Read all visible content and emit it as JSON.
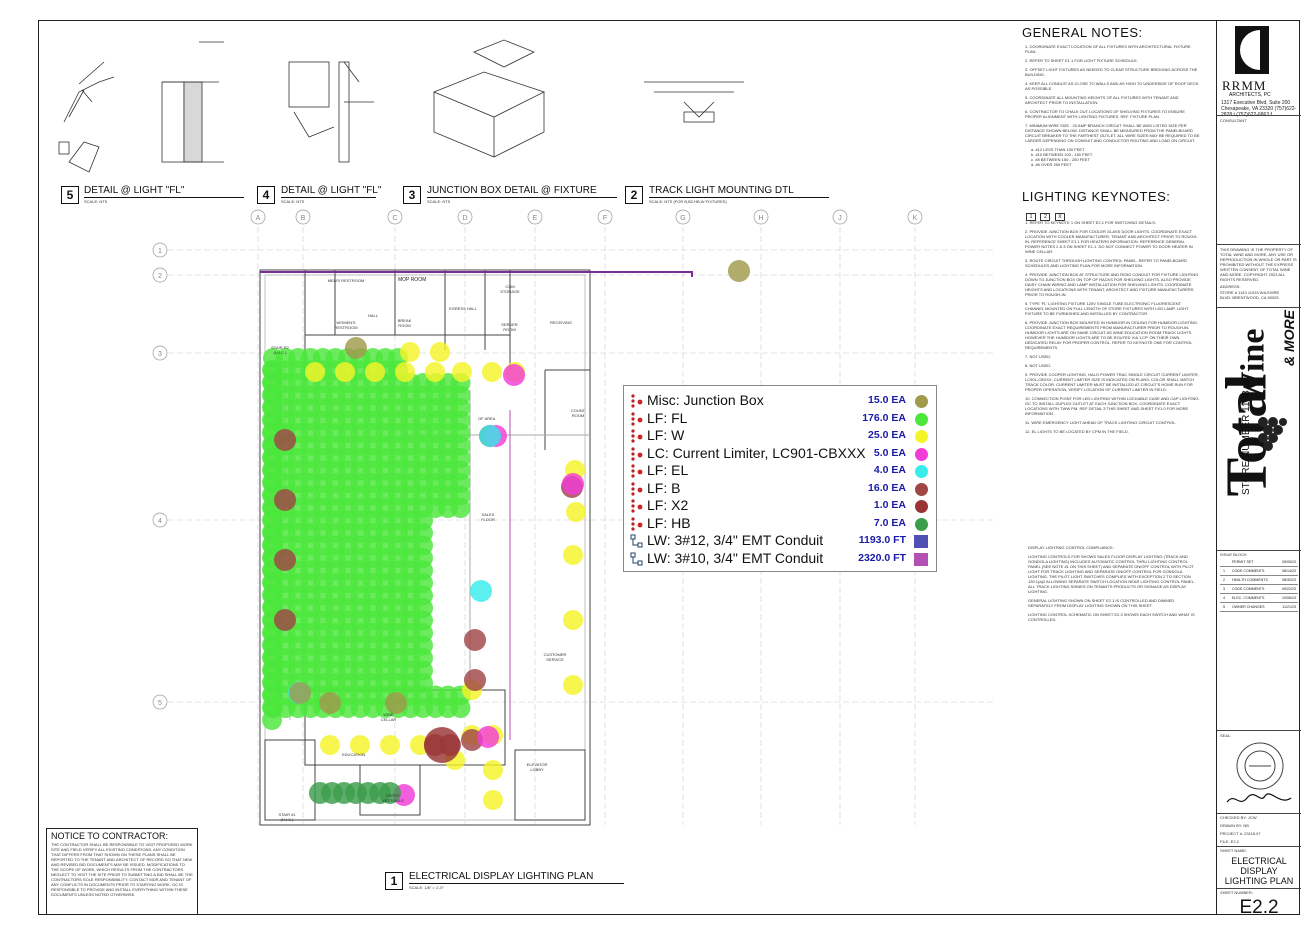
{
  "details": [
    {
      "num": "5",
      "title": "DETAIL @ LIGHT \"FL\"",
      "scale": "SCALE: NTS"
    },
    {
      "num": "4",
      "title": "DETAIL @ LIGHT \"FL\"",
      "scale": "SCALE: NTS"
    },
    {
      "num": "3",
      "title": "JUNCTION BOX DETAIL @ FIXTURE",
      "scale": "SCALE: NTS"
    },
    {
      "num": "2",
      "title": "TRACK LIGHT MOUNTING DTL",
      "scale": "SCALE: NTS (FOR B,B2,HB,W FIXTURES)"
    }
  ],
  "plan": {
    "num": "1",
    "title": "ELECTRICAL DISPLAY LIGHTING PLAN",
    "scale": "SCALE: 1/8\" = 1'-0\""
  },
  "grid_cols": [
    "A",
    "B",
    "C",
    "D",
    "E",
    "F",
    "G",
    "H",
    "J",
    "K"
  ],
  "grid_rows": [
    "1",
    "2",
    "3",
    "4",
    "5"
  ],
  "general_notes": {
    "title": "GENERAL NOTES:",
    "items": [
      "1.  COORDINATE EXACT LOCATION OF ALL FIXTURES WITH ARCHITECTURAL FIXTURE PLAN.",
      "2.  REFER TO SHEET E1.1 FOR LIGHT FIXTURE SCHEDULE.",
      "3.  OFFSET LIGHT FIXTURES AS NEEDED TO CLEAR STRUCTURE BRIDGING ACROSS THE BUILDING.",
      "4.  KEEP ALL CONDUIT AS CLOSE TO WALLS AND AS HIGH TO UNDERSIDE OF ROOF DECK AS POSSIBLE.",
      "5.  COORDINATE ALL MOUNTING HEIGHTS OF ALL FIXTURES WITH TENANT AND ARCHITECT PRIOR TO INSTALLATION.",
      "6.  CONTRACTOR TO CHALK OUT LOCATIONS OF SHELVING FIXTURES TO ENSURE PROPER ALIGNMENT WITH LIGHTING FIXTURES. REF. FIXTURE PLAN.",
      "7.  MINIMUM WIRE SIZE - 20 AMP BRANCH CIRCUIT SHALL BE AWG LISTED SIZE PER DISTANCE SHOWN BELOW. DISTANCE SHALL BE MEASURED FROM THE PANELBOARD CIRCUIT BREAKER TO THE FARTHEST OUTLET. ALL WIRE SIZES MAY BE REQUIRED TO BE LARGER DEPENDING ON CONDUIT AND CONDUCTOR ROUTING AND LOAD ON CIRCUIT."
    ],
    "wire_sizes": [
      "a. #12 LESS THAN 100 FEET",
      "b. #10 BETWEEN 100 - 150 FEET",
      "c. #8 BETWEEN 150 - 250 FEET",
      "d. #6 OVER 250 FEET"
    ]
  },
  "keynotes": {
    "title": "LIGHTING KEYNOTES:",
    "boxes": [
      "1",
      "2",
      "X"
    ],
    "items": [
      "1.  REFER TO KEYNOTE 1 ON SHEET E2.1 FOR SWITCHING DETAILS.",
      "2.  PROVIDE JUNCTION BOX FOR COOLER GLASS DOOR LIGHTS. COORDINATE EXACT LOCATION WITH COOLER MANUFACTURER, TENANT AND ARCHITECT PRIOR TO ROUGH-IN. REFERENCE SHEET E1.1 FOR HEATERS INFORMATION. REFERENCE GENERAL POWER NOTES 2 & 3 ON SHEET E1.1. DO NOT CONNECT POWER TO DOOR HEATER IN WINE CELLAR.",
      "3.  ROUTE CIRCUIT THROUGH LIGHTING CONTROL PANEL. REFER TO PANELBOARD SCHEDULES AND LIGHTING PLAN FOR MORE INFORMATION.",
      "4.  PROVIDE JUNCTION BOX AT STRUCTURE AND RIGID CONDUIT FOR FIXTURE LIGHTING DOWN TO JUNCTION BOX ON TOP OF RACKS FOR SHELVING LIGHTS. ALSO PROVIDE DAISY CHAIN WIRING AND LAMP INSTALLATION FOR SHELVING LIGHTS. COORDINATE HEIGHTS AND LOCATIONS WITH TENANT, ARCHITECT AND FIXTURE MANUFACTURERS PRIOR TO ROUGH-IN.",
      "5.  TYPE 'FL' LIGHTING FIXTURE 120V SINGLE TUBE ELECTRONIC FLUORESCENT CHANNEL MOUNTED ON FULL LENGTH OF STORE FIXTURES WITH LED LAMP. LIGHT FIXTURE TO BE FURNISHED AND INSTALLED BY CONTRACTOR.",
      "6.  PROVIDE JUNCTION BOX MOUNTED IN HUMIDOR IN CEILING FOR HUMIDOR LIGHTING. COORDINATE EXACT REQUIREMENTS FROM MANUFACTURER PRIOR TO ROUGH-IN. HUMIDOR LIGHTS ARE ON SAME CIRCUIT AS WINE EDUCATION ROOM TRACK LIGHTS HOWEVER THE HUMIDOR LIGHTS ARE TO BE ROUTED VIA 'LCP' ON THEIR OWN DEDICATED RELAY FOR PROPER CONTROL. REFER TO KEYNOTE ONE FOR CONTROL REQUIREMENTS.",
      "7.  NOT USED.",
      "8.  NOT USED.",
      "9.  PROVIDE COOPER LIGHTING, HALO POWER TRAC SINGLE CIRCUIT CURRENT LIMITER, LC901-CBXXX, CURRENT LIMITER SIZE IS INDICATED ON PLANS, COLOR SHALL MATCH TRACK COLOR. CURRENT LIMITER MUST BE INSTALLED AT CIRCUIT'S HOME RUN FOR PROPER OPERATION, VERIFY LOCATION OF CURRENT LIMITER IN FIELD.",
      "10.  CONNECTION POINT FOR LED LIGHTING WITHIN LOCKABLE CASE AND CAP LIGHTING. GC TO INSTALL DUPLEX OUTLET AT EACH JUNCTION BOX. COORDINATE EXACT LOCATIONS WITH TWW PM. REF DETAIL 3 THIS SHEET AND SHEET FX1.0 FOR MORE INFORMATION.",
      "11.  WIRE EMERGENCY LIGHT AHEAD OF TRACK LIGHTING CIRCUIT CONTROL.",
      "12.  EL LIGHTS TO BE LOCATED BY CPM IN THE FIELD."
    ]
  },
  "compliance": {
    "title": "DISPLAY LIGHTING CONTROL COMPLIANCE:",
    "paragraphs": [
      "LIGHTING CONTROLS FOR SHOWS SALES FLOOR DISPLAY LIGHTING (TRACK AND GONDOLA LIGHTING) INCLUDES AUTOMATIC CONTROL THRU LIGHTING CONTROL PANEL (SEE NOTE #1 ON THIS SHEET) AND SEPARATE ON/OFF CONTROL WITH PILOT LIGHT FOR TRACK LIGHTING AND SEPARATE ON/OFF CONTROL FOR GONDOLA LIGHTING. THE PILOT LIGHT SWITCHES COMPLIES WITH EXCEPTION 2 TO SECTION 130.1(a)2 ALLOWING SEPARATE SWITCH LOCATION NEAR LIGHTING CONTROL PANEL. ALL TRACK LIGHTING SHINES ON TENANTS PRODUCTS OR SIGNAGE AS DISPLAY LIGHTING.",
      "GENERAL LIGHTING SHOWN ON SHEET E2.1 IS CONTROLLED AND DIMMED SEPARATELY FROM DISPLAY LIGHTING SHOWN ON THIS SHEET.",
      "LIGHTING CONTROL SCHEMATIC ON SHEET E2.3 SHOWS EACH SWITCH AND WHAT IS CONTROLLED."
    ]
  },
  "legend": [
    {
      "label": "Misc: Junction Box",
      "value": "15.0 EA",
      "color": "#a09a4c",
      "shape": "circle",
      "icon": "dot-chain-icon"
    },
    {
      "label": "LF: FL",
      "value": "176.0 EA",
      "color": "#4ce63c",
      "shape": "circle",
      "icon": "dot-chain-icon"
    },
    {
      "label": "LF: W",
      "value": "25.0 EA",
      "color": "#f4f428",
      "shape": "circle",
      "icon": "dot-chain-icon"
    },
    {
      "label": "LC: Current Limiter, LC901-CBXXX",
      "value": "5.0 EA",
      "color": "#f23cd8",
      "shape": "circle",
      "icon": "dot-chain-icon"
    },
    {
      "label": "LF: EL",
      "value": "4.0 EA",
      "color": "#38ecec",
      "shape": "circle",
      "icon": "dot-chain-icon"
    },
    {
      "label": "LF: B",
      "value": "16.0 EA",
      "color": "#a04646",
      "shape": "circle",
      "icon": "dot-chain-icon"
    },
    {
      "label": "LF: X2",
      "value": "1.0 EA",
      "color": "#9a3434",
      "shape": "circle",
      "icon": "dot-chain-icon"
    },
    {
      "label": "LF: HB",
      "value": "7.0 EA",
      "color": "#3c9e4c",
      "shape": "circle",
      "icon": "dot-chain-icon"
    },
    {
      "label": "LW: 3#12, 3/4\" EMT Conduit",
      "value": "1193.0 FT",
      "color": "#5050b4",
      "shape": "square",
      "icon": "run-icon"
    },
    {
      "label": "LW: 3#10, 3/4\" EMT Conduit",
      "value": "2320.0 FT",
      "color": "#b450b4",
      "shape": "square",
      "icon": "run-icon"
    }
  ],
  "rooms": [
    "MEN'S RESTROOM",
    "MOP ROOM",
    "WOMEN'S RESTROOM",
    "HALL",
    "BREAK ROOM",
    "EGRESS HALL",
    "COM STORAGE",
    "SERVER ROOM",
    "RECEIVING",
    "STAIR R2 (N.I.C.)",
    "COUNT ROOM",
    "OF AREA",
    "SALES FLOOR",
    "CUSTOMER SERVICE",
    "WINE CELLAR",
    "EDUCATION",
    "ELEVATOR LOBBY",
    "ENTRY VESTIBULE",
    "STAIR #1 (N.I.C.)"
  ],
  "notice": {
    "title": "NOTICE TO CONTRACTOR:",
    "body": "THE CONTRACTOR SHALL BE RESPONSIBLE TO VISIT PROPOSED WORK SITE AND FIELD VERIFY ALL EXISTING CONDITIONS. ANY CONDITION THAT DIFFERS FROM THAT SHOWN ON THESE PLANS SHALL BE REPORTED TO THE TENANT AND ARCHITECT OF RECORD SO THAT NEW AND REVISED BID DOCUMENTS MAY BE ISSUED. MODIFICATIONS TO THE SCOPE OF WORK, WHICH RESULTS FROM THE CONTRACTORS NEGLECT TO VISIT THE SITE PRIOR TO SUBMITTING A BID SHALL BE THE CONTRACTORS SOLE RESPONSIBILITY. CONTACT MDR AND TENANT OF ANY CONFLICTS IN DOCUMENTS PRIOR TO STARTING WORK. GC IS RESPONSIBLE TO PROVIDE AND INSTALL EVERYTHING WITHIN THESE DOCUMENTS UNLESS NOTED OTHERWISE."
  },
  "title_block": {
    "firm": "RRMM",
    "firm_sub": "ARCHITECTS, PC",
    "address": "1317 Executive Blvd, Suite 200 Chesapeake, VA 23320 (757)622-2828 t (757)622-6863 f",
    "consultant": "CONSULTANT",
    "property": "THIS DRAWING IS THE PROPERTY OF TOTAL WINE AND MORE. ANY USE OR REPRODUCTION IN WHOLE OR PART IS PROHIBITED WITHOUT THE EXPRESS WRITTEN CONSENT OF TOTAL WINE AND MORE. COPYRIGHT 2023 ALL RIGHTS RESERVED.",
    "address_label": "ADDRESS:",
    "store_address": "STORE # 1143 11915 WILSHIRE BLVD. BRENTWOOD, CA 90025",
    "brand_main": "Total",
    "brand_wine": "Wine",
    "brand_more": "& MORE",
    "store_number": "STORE NUMBER 1143",
    "issue_block": "ISSUE BLOCK",
    "issues": [
      {
        "num": "",
        "label": "PERMIT SET",
        "date": "05/05/23"
      },
      {
        "num": "1",
        "label": "CODE COMMENTS",
        "date": "08/14/23"
      },
      {
        "num": "2",
        "label": "HEALTH COMMENTS",
        "date": "08/30/23"
      },
      {
        "num": "3",
        "label": "CODE COMMENTS",
        "date": "09/22/23"
      },
      {
        "num": "4",
        "label": "ELEC. COMMENTS",
        "date": "10/06/23"
      },
      {
        "num": "5",
        "label": "OWNER CHANGES",
        "date": "11/21/23"
      }
    ],
    "seal": "SEAL:",
    "checked_by": "CHECKED BY: JCW",
    "drawn_by": "DRAWN BY: NB",
    "project": "PROJECT #: 23118.07",
    "file": "FILE: E2.2",
    "sheet_name_label": "SHEET NAME:",
    "sheet_name": "ELECTRICAL DISPLAY LIGHTING PLAN",
    "sheet_number_label": "SHEET NUMBER:",
    "sheet_number": "E2.2"
  }
}
